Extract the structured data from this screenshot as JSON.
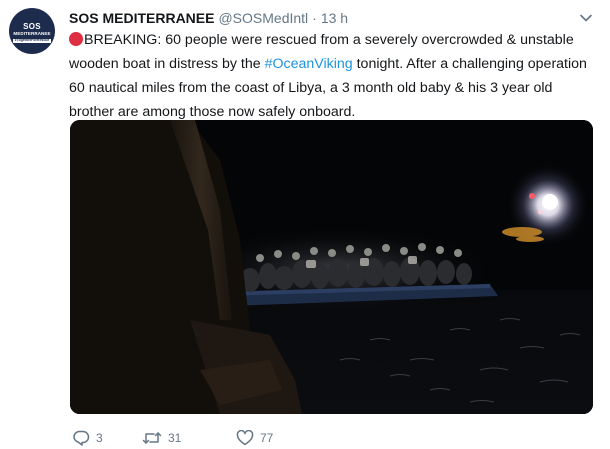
{
  "account": {
    "display_name": "SOS MEDITERRANEE",
    "handle": "@SOSMedIntl",
    "separator": "·",
    "time": "13 h",
    "avatar_text_line1": "SOS",
    "avatar_text_line2": "MEDITERRANEE",
    "avatar_text_line3": "#TogetherForRescue"
  },
  "tweet": {
    "emoji_icon": "red-circle-icon",
    "text_1": "BREAKING: 60 people were rescued from a severely overcrowded & unstable wooden boat in distress by the ",
    "hashtag": "#OceanViking",
    "text_2": " tonight. After a challenging operation 60 nautical miles from the coast of Libya, a 3 month old baby & his 3 year old brother are among those now safely onboard."
  },
  "media": {
    "kind": "photo",
    "description_icon": "night-rescue-photo"
  },
  "actions": {
    "reply_count": "3",
    "retweet_count": "31",
    "like_count": "77"
  },
  "colors": {
    "text": "#14171a",
    "secondary": "#657786",
    "link": "#1b95e0",
    "emoji_red": "#dd2e44",
    "avatar_bg": "#1d2b4c"
  }
}
